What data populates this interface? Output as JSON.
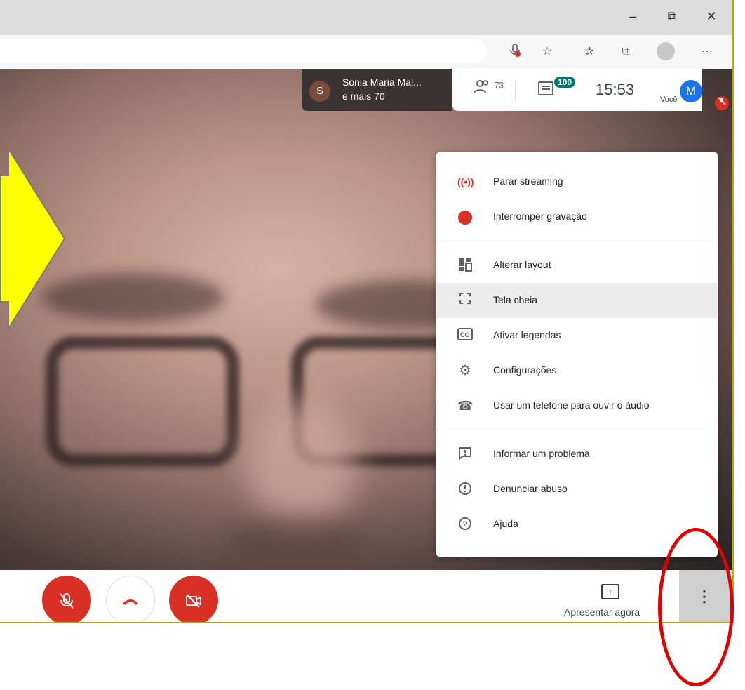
{
  "browser": {
    "window_controls": [
      "–",
      "⧉",
      "✕"
    ],
    "toolbar_icons": [
      "mic-blocked-icon",
      "favorite-star-icon",
      "favorites-list-icon",
      "collections-icon",
      "profile-icon",
      "more-icon"
    ]
  },
  "presenter": {
    "initial": "S",
    "name": "Sonia Maria Mal...",
    "sub": "e mais 70"
  },
  "info_bar": {
    "participants_count": "73",
    "chat_count": "100",
    "time": "15:53",
    "you_label": "Você",
    "you_initial": "M"
  },
  "menu": {
    "items": [
      {
        "label": "Parar streaming",
        "icon": "streaming-icon"
      },
      {
        "label": "Interromper gravação",
        "icon": "record-dot-icon"
      },
      {
        "label": "Alterar layout",
        "icon": "layout-icon"
      },
      {
        "label": "Tela cheia",
        "icon": "fullscreen-icon"
      },
      {
        "label": "Ativar legendas",
        "icon": "captions-icon"
      },
      {
        "label": "Configurações",
        "icon": "settings-gear-icon"
      },
      {
        "label": "Usar um telefone para ouvir o áudio",
        "icon": "phone-audio-icon"
      },
      {
        "label": "Informar um problema",
        "icon": "report-problem-icon"
      },
      {
        "label": "Denunciar abuso",
        "icon": "report-abuse-icon"
      },
      {
        "label": "Ajuda",
        "icon": "help-icon"
      }
    ]
  },
  "controls": {
    "present_label": "Apresentar agora"
  },
  "colors": {
    "red": "#d93025",
    "annotation_red": "#e00000",
    "arrow_yellow": "#ffff00",
    "chat_badge": "#00796b",
    "avatar_blue": "#1a73e8"
  }
}
